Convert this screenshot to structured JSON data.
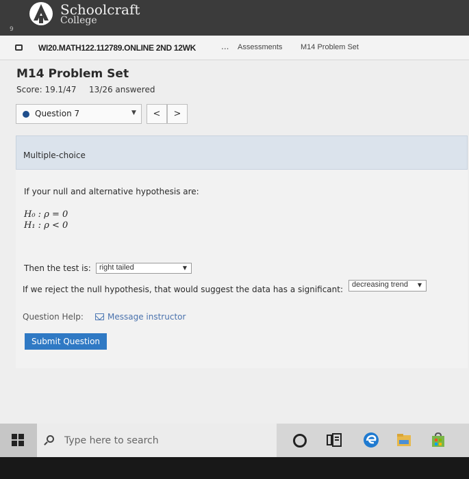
{
  "header": {
    "logo_line1": "Schoolcraft",
    "logo_line2": "College",
    "corner_glyph": "9"
  },
  "breadcrumb": {
    "course": "WI20.MATH122.112789.ONLINE 2ND 12WK",
    "ellipsis": "...",
    "assessments": "Assessments",
    "current": "M14 Problem Set"
  },
  "assignment": {
    "title": "M14 Problem Set",
    "score": "Score: 19.1/47",
    "answered": "13/26 answered"
  },
  "question_nav": {
    "selected": "Question 7",
    "caret": "▼",
    "prev": "<",
    "next": ">"
  },
  "question": {
    "type": "Multiple-choice",
    "prompt": "If your null and alternative hypothesis are:",
    "h0": "H₀ : ρ = 0",
    "h1": "H₁ : ρ < 0",
    "test_label": "Then the test is:",
    "test_value": "right tailed",
    "reject_label": "If we reject the null hypothesis, that would suggest the data has a significant:",
    "reject_value": "decreasing trend",
    "select_caret": "▼",
    "help_label": "Question Help:",
    "help_link": "Message instructor",
    "submit": "Submit Question"
  },
  "taskbar": {
    "search_placeholder": "Type here to search"
  },
  "colors": {
    "header_bg": "#3b3b3b",
    "accent": "#2f79c4",
    "panel": "#dbe3ec",
    "link": "#4a72ad"
  }
}
